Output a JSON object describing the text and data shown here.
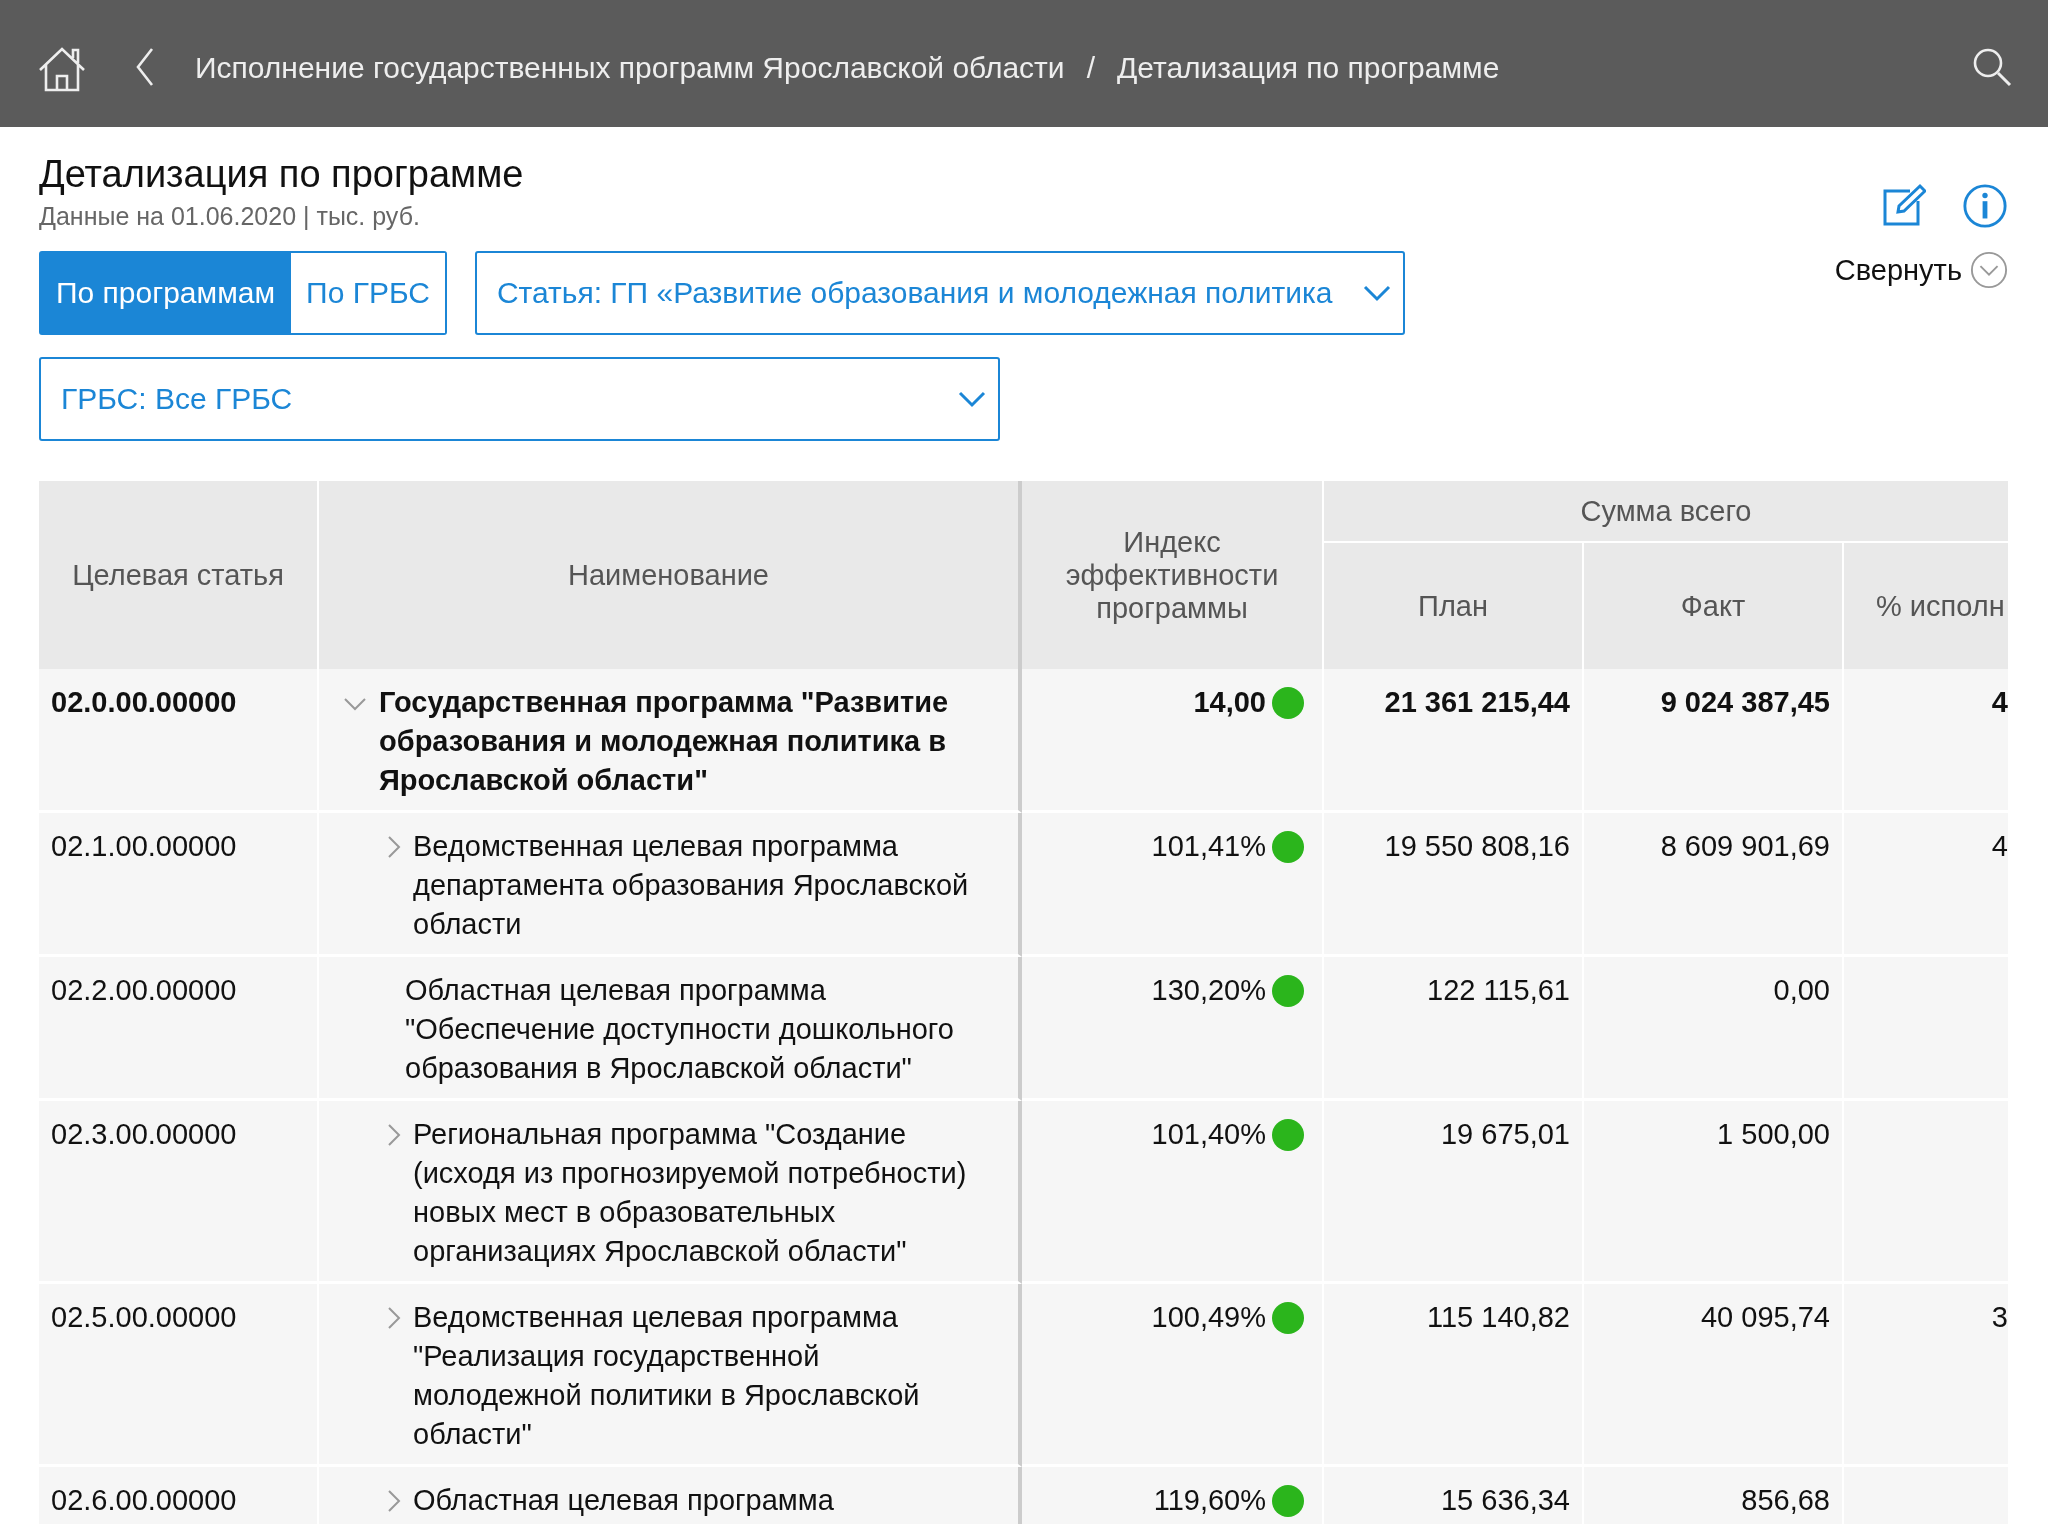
{
  "top_bar": {
    "breadcrumbs": [
      "Исполнение государственных программ Ярославской области",
      "Детализация по программе"
    ],
    "separator": "/"
  },
  "page": {
    "title": "Детализация по программе",
    "subtitle": "Данные на 01.06.2020 | тыс. руб."
  },
  "view_tabs": [
    {
      "label": "По программам",
      "selected": true
    },
    {
      "label": "По ГРБС",
      "selected": false
    }
  ],
  "filters": [
    {
      "value": "Статья: ГП «Развитие образования и молодежная политика"
    },
    {
      "value": "ГРБС: Все ГРБС"
    }
  ],
  "collapse_button": {
    "label": "Свернуть"
  },
  "table": {
    "columns": {
      "code": "Целевая статья",
      "name": "Наименование",
      "index": "Индекс эффективности программы",
      "sum_group": "Сумма всего",
      "plan": "План",
      "fact": "Факт",
      "percent": "% исполн"
    },
    "rows": [
      {
        "code": "02.0.00.00000",
        "name": "Государственная программа \"Развитие образования и молодежная политика в Ярославской области\"",
        "index": "14,00",
        "color": "#2bb51c",
        "plan": "21 361 215,44",
        "fact": "9 024 387,45",
        "percent": "4",
        "expanded": true,
        "children": [
          {
            "code": "02.1.00.00000",
            "name": "Ведомственная целевая программа департамента образования Ярославской области",
            "index": "101,41%",
            "color": "#2bb51c",
            "plan": "19 550 808,16",
            "fact": "8 609 901,69",
            "percent": "4",
            "expanded": false
          },
          {
            "code": "02.2.00.00000",
            "name": "Областная целевая программа \"Обеспечение доступности дошкольного образования в Ярославской области\"",
            "index": "130,20%",
            "color": "#2bb51c",
            "plan": "122 115,61",
            "fact": "0,00"
          },
          {
            "code": "02.3.00.00000",
            "name": "Региональная программа \"Создание (исходя из прогнозируемой потребности) новых мест в образовательных организациях Ярославской области\"",
            "index": "101,40%",
            "color": "#2bb51c",
            "plan": "19 675,01",
            "fact": "1 500,00",
            "expanded": false
          },
          {
            "code": "02.5.00.00000",
            "name": "Ведомственная целевая программа \"Реализация государственной молодежной политики в Ярославской области\"",
            "index": "100,49%",
            "color": "#2bb51c",
            "plan": "115 140,82",
            "fact": "40 095,74",
            "percent": "3",
            "expanded": false
          },
          {
            "code": "02.6.00.00000",
            "name": "Областная целевая программа",
            "index": "119,60%",
            "color": "#2bb51c",
            "plan": "15 636,34",
            "fact": "856,68",
            "expanded": false
          }
        ]
      }
    ]
  }
}
